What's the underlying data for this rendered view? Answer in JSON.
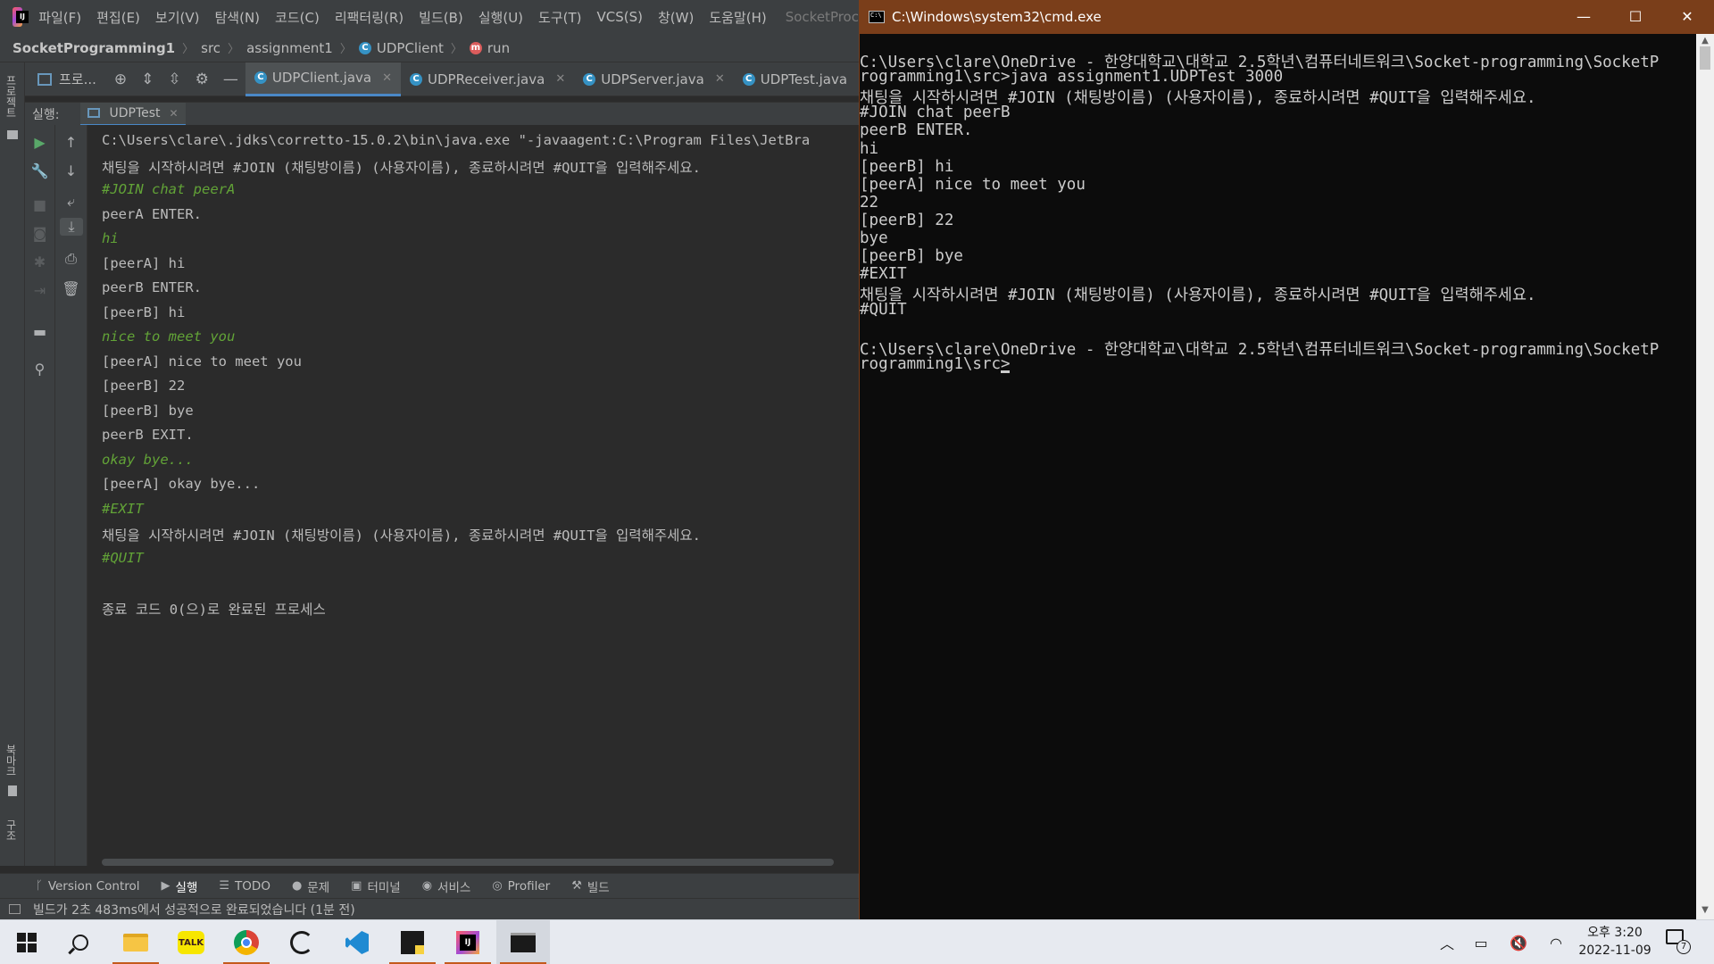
{
  "ide": {
    "menu": [
      "파일(F)",
      "편집(E)",
      "보기(V)",
      "탐색(N)",
      "코드(C)",
      "리팩터링(R)",
      "빌드(B)",
      "실행(U)",
      "도구(T)",
      "VCS(S)",
      "창(W)",
      "도움말(H)"
    ],
    "window_title_fragment": "SocketProc",
    "breadcrumb": [
      "SocketProgramming1",
      "src",
      "assignment1",
      "UDPClient",
      "run"
    ],
    "left_stripe_top": "프로젝트",
    "left_stripe_bottom_1": "북마크",
    "left_stripe_bottom_2": "구조",
    "project_button": "프로...",
    "tabs": [
      {
        "label": "UDPClient.java",
        "active": true
      },
      {
        "label": "UDPReceiver.java",
        "active": false
      },
      {
        "label": "UDPServer.java",
        "active": false
      },
      {
        "label": "UDPTest.java",
        "active": false
      }
    ],
    "run": {
      "label": "실행:",
      "tab": "UDPTest",
      "console": [
        {
          "text": "C:\\Users\\clare\\.jdks\\corretto-15.0.2\\bin\\java.exe \"-javaagent:C:\\Program Files\\JetBra",
          "input": false
        },
        {
          "text": "채팅을 시작하시려면 #JOIN (채팅방이름) (사용자이름), 종료하시려면 #QUIT을 입력해주세요.",
          "input": false
        },
        {
          "text": "#JOIN chat peerA",
          "input": true
        },
        {
          "text": "peerA ENTER.",
          "input": false
        },
        {
          "text": "hi",
          "input": true
        },
        {
          "text": "[peerA] hi",
          "input": false
        },
        {
          "text": "peerB ENTER.",
          "input": false
        },
        {
          "text": "[peerB] hi",
          "input": false
        },
        {
          "text": "nice to meet you",
          "input": true
        },
        {
          "text": "[peerA] nice to meet you",
          "input": false
        },
        {
          "text": "[peerB] 22",
          "input": false
        },
        {
          "text": "[peerB] bye",
          "input": false
        },
        {
          "text": "peerB EXIT.",
          "input": false
        },
        {
          "text": "okay bye...",
          "input": true
        },
        {
          "text": "[peerA] okay bye...",
          "input": false
        },
        {
          "text": "#EXIT",
          "input": true
        },
        {
          "text": "채팅을 시작하시려면 #JOIN (채팅방이름) (사용자이름), 종료하시려면 #QUIT을 입력해주세요.",
          "input": false
        },
        {
          "text": "#QUIT",
          "input": true
        },
        {
          "text": "",
          "input": false
        },
        {
          "text": "종료 코드 0(으)로 완료된 프로세스",
          "input": false
        }
      ]
    },
    "bottom_tools": [
      "Version Control",
      "실행",
      "TODO",
      "문제",
      "터미널",
      "서비스",
      "Profiler",
      "빌드"
    ],
    "status": "빌드가 2초 483ms에서 성공적으로 완료되었습니다 (1분 전)"
  },
  "cmd": {
    "title": "C:\\Windows\\system32\\cmd.exe",
    "lines": [
      "C:\\Users\\clare\\OneDrive - 한양대학교\\대학교 2.5학년\\컴퓨터네트워크\\Socket-programming\\SocketP",
      "rogramming1\\src>java assignment1.UDPTest 3000",
      "채팅을 시작하시려면 #JOIN (채팅방이름) (사용자이름), 종료하시려면 #QUIT을 입력해주세요.",
      "#JOIN chat peerB",
      "peerB ENTER.",
      "hi",
      "[peerB] hi",
      "[peerA] nice to meet you",
      "22",
      "[peerB] 22",
      "bye",
      "[peerB] bye",
      "#EXIT",
      "채팅을 시작하시려면 #JOIN (채팅방이름) (사용자이름), 종료하시려면 #QUIT을 입력해주세요.",
      "#QUIT",
      "",
      "C:\\Users\\clare\\OneDrive - 한양대학교\\대학교 2.5학년\\컴퓨터네트워크\\Socket-programming\\SocketP",
      "rogramming1\\src>"
    ]
  },
  "taskbar": {
    "time": "오후 3:20",
    "date": "2022-11-09",
    "notification_count": "7",
    "kakaotalk_label": "TALK"
  },
  "colors": {
    "ide_bg": "#2b2b2b",
    "ide_panel": "#3c3f41",
    "console_input": "#62a337",
    "cmd_title": "#7a3e1a",
    "taskbar": "#e7eaf0"
  }
}
